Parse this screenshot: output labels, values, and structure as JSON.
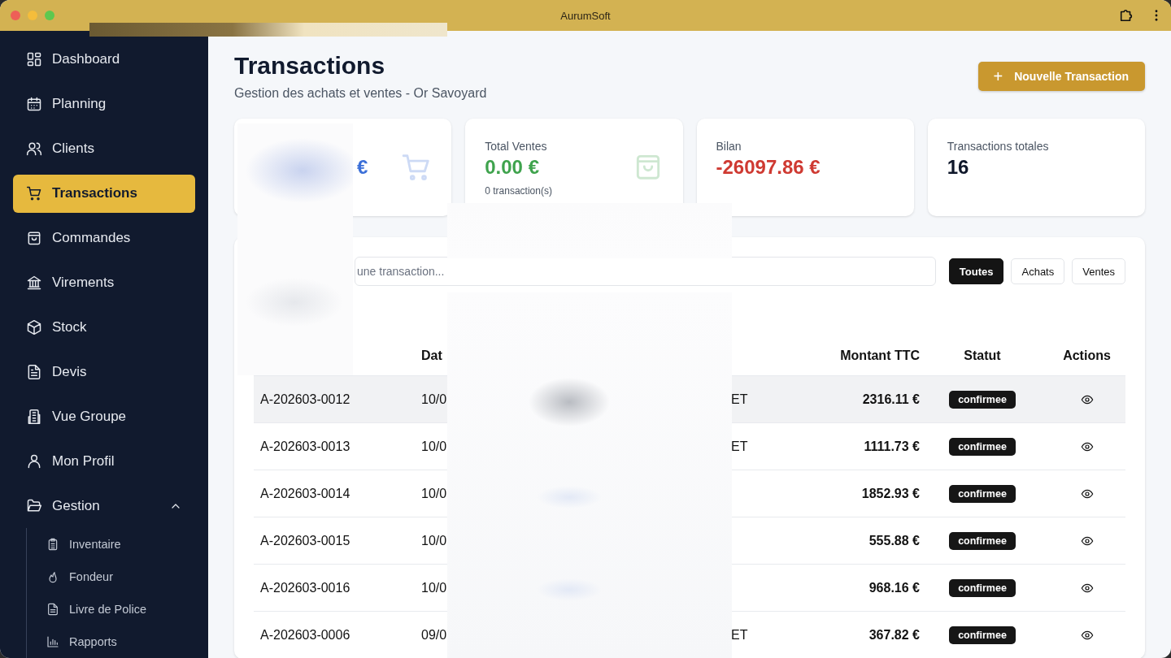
{
  "window": {
    "title": "AurumSoft"
  },
  "sidebar": {
    "items": [
      {
        "label": "Dashboard",
        "selected": false
      },
      {
        "label": "Planning",
        "selected": false
      },
      {
        "label": "Clients",
        "selected": false
      },
      {
        "label": "Transactions",
        "selected": true
      },
      {
        "label": "Commandes",
        "selected": false
      },
      {
        "label": "Virements",
        "selected": false
      },
      {
        "label": "Stock",
        "selected": false
      },
      {
        "label": "Devis",
        "selected": false
      },
      {
        "label": "Vue Groupe",
        "selected": false
      },
      {
        "label": "Mon Profil",
        "selected": false
      },
      {
        "label": "Gestion",
        "selected": false,
        "expanded": true,
        "children": [
          {
            "label": "Inventaire",
            "selected": false
          },
          {
            "label": "Fondeur",
            "selected": false
          },
          {
            "label": "Livre de Police",
            "selected": false
          },
          {
            "label": "Rapports",
            "selected": false
          }
        ]
      }
    ]
  },
  "header": {
    "title": "Transactions",
    "subtitle": "Gestion des achats et ventes - Or Savoyard",
    "button": {
      "icon": "+",
      "label": "Nouvelle Transaction"
    }
  },
  "stats": [
    {
      "kind": "partial",
      "value": "€",
      "color": "#3b6fd8"
    },
    {
      "kind": "full",
      "label": "Total Ventes",
      "value": "0.00 €",
      "note": "0 transaction(s)",
      "color": "#3fa34d"
    },
    {
      "kind": "full",
      "label": "Bilan",
      "value": "-26097.86 €",
      "color": "#cf3a32"
    },
    {
      "kind": "full",
      "label": "Transactions totales",
      "value": "16",
      "color": "#0f172a"
    }
  ],
  "search": {
    "placeholder": "une transaction..."
  },
  "filters": [
    {
      "label": "Toutes",
      "selected": true
    },
    {
      "label": "Achats",
      "selected": false
    },
    {
      "label": "Ventes",
      "selected": false
    }
  ],
  "table": {
    "columns": [
      "Dat",
      "Montant TTC",
      "Statut",
      "Actions"
    ],
    "rows": [
      {
        "reference": "A-202603-0012",
        "date": "10/0",
        "column_4": "ET",
        "amount": "2316.11 €",
        "status": "confirmee",
        "highlighted": true
      },
      {
        "reference": "A-202603-0013",
        "date": "10/0",
        "column_4": "ET",
        "amount": "1111.73 €",
        "status": "confirmee",
        "highlighted": false
      },
      {
        "reference": "A-202603-0014",
        "date": "10/0",
        "amount": "1852.93 €",
        "status": "confirmee",
        "highlighted": false
      },
      {
        "reference": "A-202603-0015",
        "date": "10/0",
        "amount": "555.88 €",
        "status": "confirmee",
        "highlighted": false
      },
      {
        "reference": "A-202603-0016",
        "date": "10/0",
        "amount": "968.16 €",
        "status": "confirmee",
        "highlighted": false
      },
      {
        "reference": "A-202603-0006",
        "date": "09/0",
        "column_4": "ET",
        "amount": "367.82 €",
        "status": "confirmee",
        "highlighted": false
      }
    ]
  }
}
